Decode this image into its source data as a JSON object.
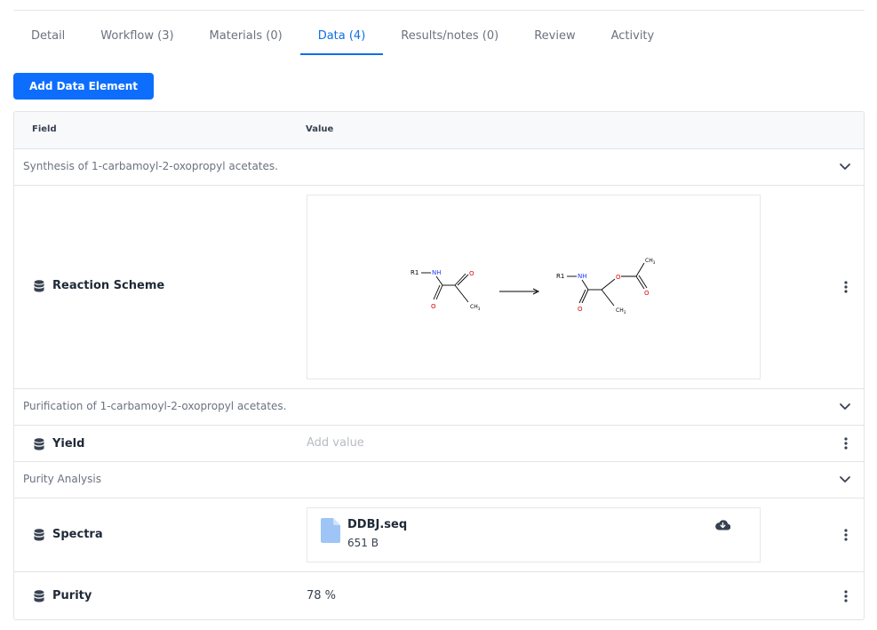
{
  "tabs": [
    {
      "label": "Detail"
    },
    {
      "label": "Workflow (3)"
    },
    {
      "label": "Materials (0)"
    },
    {
      "label": "Data (4)"
    },
    {
      "label": "Results/notes (0)"
    },
    {
      "label": "Review"
    },
    {
      "label": "Activity"
    }
  ],
  "active_tab_index": 3,
  "add_button_label": "Add Data Element",
  "table": {
    "header_field": "Field",
    "header_value": "Value"
  },
  "sections": [
    {
      "title": "Synthesis of 1-carbamoyl-2-oxopropyl acetates."
    },
    {
      "title": "Purification of 1-carbamoyl-2-oxopropyl acetates."
    },
    {
      "title": "Purity Analysis"
    }
  ],
  "fields": {
    "reaction_scheme": {
      "label": "Reaction Scheme",
      "structure_labels": {
        "r1": "R1",
        "nh": "NH",
        "o": "O",
        "ch3": "CH",
        "sub3": "3"
      }
    },
    "yield": {
      "label": "Yield",
      "placeholder": "Add value"
    },
    "spectra": {
      "label": "Spectra",
      "file_name": "DDBJ.seq",
      "file_size": "651 B"
    },
    "purity": {
      "label": "Purity",
      "value": "78 %"
    }
  },
  "colors": {
    "accent": "#0d6efd",
    "active_tab": "#0f6fe8",
    "border": "#e2e4e7",
    "muted_text": "#6b7280",
    "placeholder": "#b8bcc4",
    "nitrogen": "#1e3aff",
    "oxygen": "#e00000",
    "file_icon": "#9ec5f5"
  },
  "icons": {
    "field": "database-icon",
    "section_toggle": "chevron-down-icon",
    "row_menu": "kebab-menu-icon",
    "file": "file-icon",
    "download": "cloud-download-icon"
  }
}
